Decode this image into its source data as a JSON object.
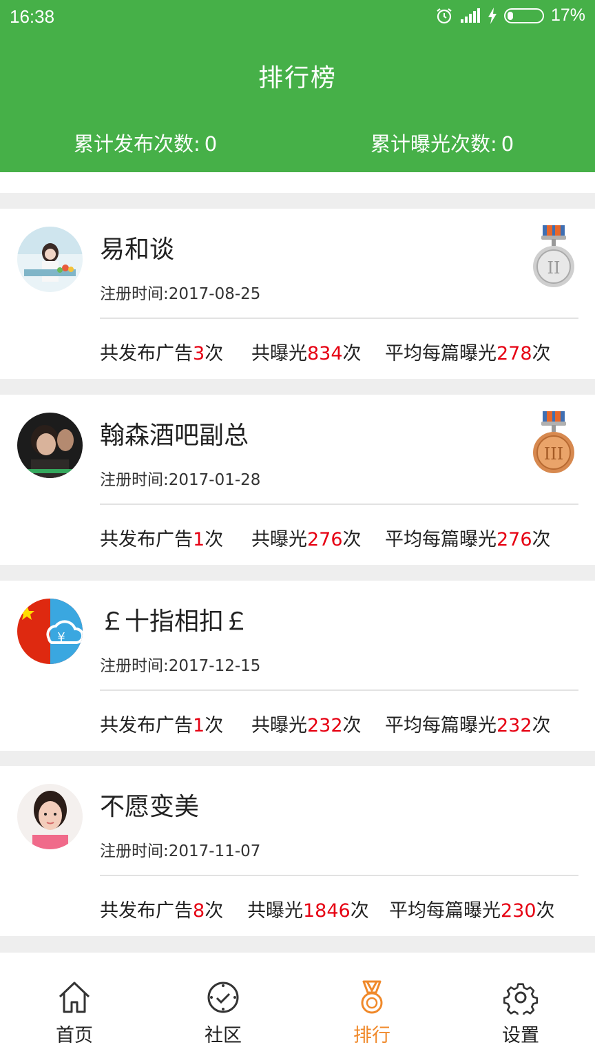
{
  "status_bar": {
    "time": "16:38",
    "battery": "17%"
  },
  "header": {
    "title": "排行榜",
    "total_posts_label": "累计发布次数:",
    "total_posts_value": "0",
    "total_exposure_label": "累计曝光次数:",
    "total_exposure_value": "0"
  },
  "labels": {
    "reg_label": "注册时间:",
    "posts_prefix": "共发布广告",
    "exposure_prefix": "共曝光",
    "avg_prefix": "平均每篇曝光",
    "times_suffix": "次"
  },
  "users": [
    {
      "name": "易和谈",
      "reg_date": "2017-08-25",
      "posts": "3",
      "exposure": "834",
      "avg": "278",
      "medal": "silver"
    },
    {
      "name": "翰森酒吧副总",
      "reg_date": "2017-01-28",
      "posts": "1",
      "exposure": "276",
      "avg": "276",
      "medal": "bronze"
    },
    {
      "name": "￡十指相扣￡",
      "reg_date": "2017-12-15",
      "posts": "1",
      "exposure": "232",
      "avg": "232",
      "medal": ""
    },
    {
      "name": "不愿变美",
      "reg_date": "2017-11-07",
      "posts": "8",
      "exposure": "1846",
      "avg": "230",
      "medal": ""
    }
  ],
  "nav": {
    "items": [
      {
        "label": "首页",
        "icon": "home-icon"
      },
      {
        "label": "社区",
        "icon": "compass-icon"
      },
      {
        "label": "排行",
        "icon": "medal-icon"
      },
      {
        "label": "设置",
        "icon": "gear-icon"
      }
    ],
    "active": "排行"
  },
  "colors": {
    "primary": "#46b048",
    "highlight": "#e60012",
    "active_tab": "#f0892a"
  }
}
